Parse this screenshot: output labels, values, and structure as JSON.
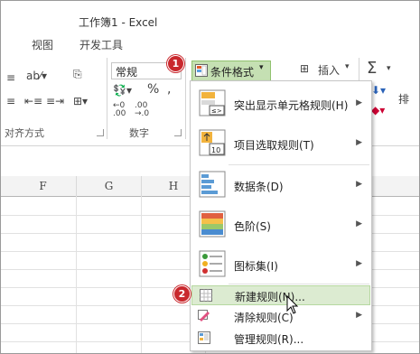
{
  "window": {
    "title": "工作簿1 - Excel"
  },
  "ribbon_tabs": [
    "视图",
    "开发工具"
  ],
  "ribbon": {
    "alignment_group_label": "对齐方式",
    "number_group_label": "数字",
    "number_format_value": "常规",
    "percent_symbol": "%",
    "comma_symbol": ",",
    "conditional_formatting_label": "条件格式",
    "insert_label": "插入",
    "sort_partial_label": "排"
  },
  "callouts": {
    "step1": "1",
    "step2": "2"
  },
  "sheet": {
    "columns": [
      "F",
      "G",
      "H"
    ]
  },
  "menu": {
    "items": [
      {
        "label": "突出显示单元格规则(H)",
        "has_submenu": true,
        "icon": "highlight-cells-icon"
      },
      {
        "label": "项目选取规则(T)",
        "has_submenu": true,
        "icon": "top-bottom-icon"
      },
      {
        "label": "数据条(D)",
        "has_submenu": true,
        "icon": "data-bars-icon"
      },
      {
        "label": "色阶(S)",
        "has_submenu": true,
        "icon": "color-scales-icon"
      },
      {
        "label": "图标集(I)",
        "has_submenu": true,
        "icon": "icon-sets-icon"
      },
      {
        "label": "新建规则(N)...",
        "has_submenu": false,
        "icon": "new-rule-icon",
        "highlighted": true
      },
      {
        "label": "清除规则(C)",
        "has_submenu": true,
        "icon": "clear-rules-icon"
      },
      {
        "label": "管理规则(R)...",
        "has_submenu": false,
        "icon": "manage-rules-icon"
      }
    ]
  },
  "colors": {
    "accent_green": "#c5e0b3",
    "hover_green": "#dcebd1",
    "badge_red": "#c9282d"
  }
}
